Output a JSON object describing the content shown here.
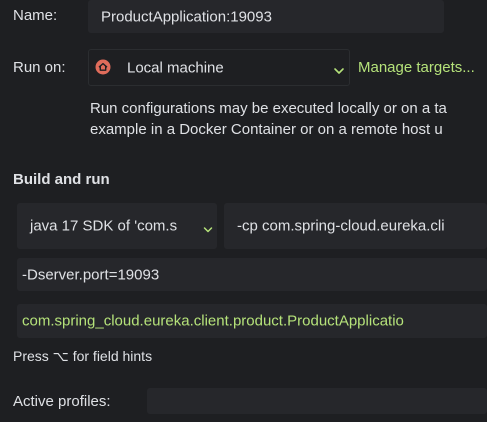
{
  "name_row": {
    "label": "Name:",
    "value": "ProductApplication:19093"
  },
  "run_on_row": {
    "label": "Run on:",
    "target": "Local machine",
    "target_icon": "home-icon",
    "manage_link": "Manage targets...",
    "description_line1": "Run configurations may be executed locally or on a ta",
    "description_line2": "example in a Docker Container or on a remote host u"
  },
  "build_and_run": {
    "title": "Build and run",
    "sdk": "java 17 SDK of 'com.s",
    "classpath": "-cp com.spring-cloud.eureka.cli",
    "vm_options": "-Dserver.port=19093",
    "main_class": "com.spring_cloud.eureka.client.product.ProductApplicatio",
    "hint": "Press ⌥ for field hints"
  },
  "profiles_row": {
    "label": "Active profiles:",
    "value": ""
  },
  "colors": {
    "background": "#1e1f22",
    "field": "#26272b",
    "link_green": "#b5e27a",
    "icon_red": "#e06c5b"
  }
}
